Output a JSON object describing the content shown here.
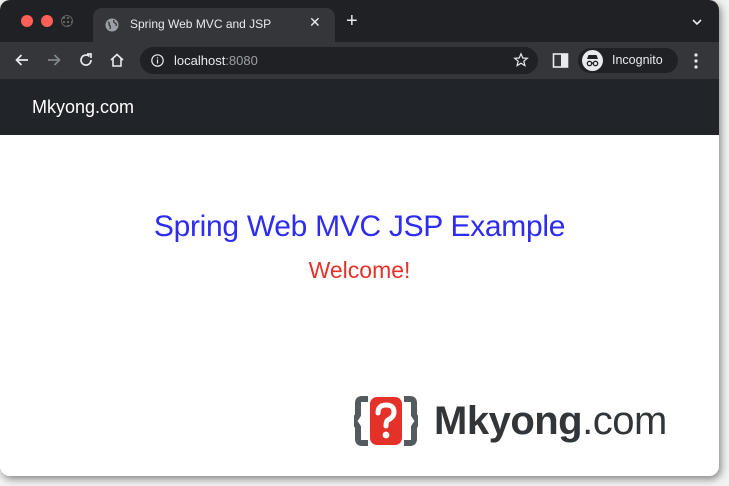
{
  "browser": {
    "tab": {
      "title": "Spring Web MVC and JSP",
      "favicon": "globe-icon",
      "close_glyph": "✕"
    },
    "new_tab_glyph": "+",
    "address": {
      "host": "localhost",
      "port": ":8080"
    },
    "profile": {
      "label": "Incognito",
      "icon": "incognito-icon"
    }
  },
  "page": {
    "brand": "Mkyong.com",
    "heading": "Spring Web MVC JSP Example",
    "message": "Welcome!"
  },
  "watermark": {
    "name": "Mkyong",
    "suffix": ".com"
  },
  "colors": {
    "heading": "#2e2cf0",
    "message": "#e4322b",
    "navbar": "#212529",
    "chrome_dark": "#202124",
    "chrome_toolbar": "#35363a"
  }
}
